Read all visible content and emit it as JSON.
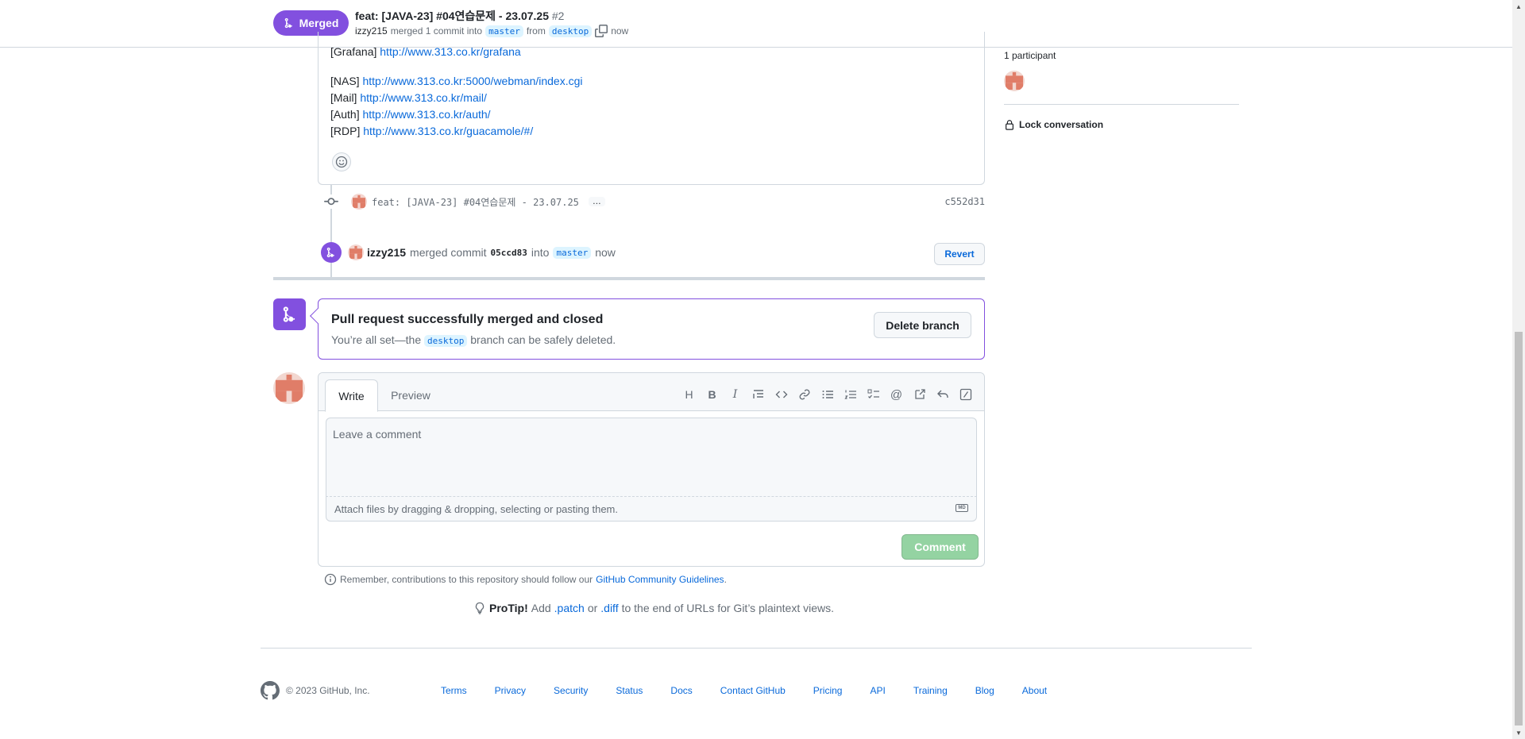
{
  "header": {
    "state_label": "Merged",
    "title": "feat: [JAVA-23] #04연습문제 - 23.07.25",
    "number": "#2",
    "author": "izzy215",
    "merged_text": "merged 1 commit into",
    "base_branch": "master",
    "from_text": "from",
    "head_branch": "desktop",
    "time": "now"
  },
  "body_links": [
    {
      "prefix": "[Grafana]",
      "url": "http://www.313.co.kr/grafana"
    },
    {
      "prefix": "[NAS]",
      "url": "http://www.313.co.kr:5000/webman/index.cgi"
    },
    {
      "prefix": "[Mail]",
      "url": "http://www.313.co.kr/mail/"
    },
    {
      "prefix": "[Auth]",
      "url": "http://www.313.co.kr/auth/"
    },
    {
      "prefix": "[RDP]",
      "url": "http://www.313.co.kr/guacamole/#/"
    }
  ],
  "commit": {
    "message": "feat: [JAVA-23] #04연습문제 - 23.07.25",
    "ellipsis": "…",
    "sha": "c552d31"
  },
  "merge_event": {
    "user": "izzy215",
    "text1": "merged commit",
    "sha": "05ccd83",
    "text2": "into",
    "branch": "master",
    "time": "now",
    "revert_label": "Revert"
  },
  "merged_card": {
    "title": "Pull request successfully merged and closed",
    "desc_pre": "You’re all set—the",
    "branch": "desktop",
    "desc_post": "branch can be safely deleted.",
    "delete_label": "Delete branch"
  },
  "new_comment": {
    "tab_write": "Write",
    "tab_preview": "Preview",
    "placeholder": "Leave a comment",
    "attach_text": "Attach files by dragging & dropping, selecting or pasting them.",
    "md_badge": "MD",
    "submit_label": "Comment",
    "toolbar": [
      "heading-icon",
      "bold-icon",
      "italic-icon",
      "quote-icon",
      "code-icon",
      "link-icon",
      "bulleted-list-icon",
      "numbered-list-icon",
      "task-list-icon",
      "mention-icon",
      "cross-reference-icon",
      "reply-icon",
      "slash-command-icon"
    ]
  },
  "remember": {
    "text": "Remember, contributions to this repository should follow our",
    "link": "GitHub Community Guidelines",
    "end": "."
  },
  "protip": {
    "label": "ProTip!",
    "t1": "Add",
    "patch": ".patch",
    "t2": "or",
    "diff": ".diff",
    "t3": "to the end of URLs for Git’s plaintext views."
  },
  "sidebar": {
    "participants": "1 participant",
    "lock_label": "Lock conversation"
  },
  "footer": {
    "copyright": "© 2023 GitHub, Inc.",
    "links": [
      "Terms",
      "Privacy",
      "Security",
      "Status",
      "Docs",
      "Contact GitHub",
      "Pricing",
      "API",
      "Training",
      "Blog",
      "About"
    ]
  },
  "colors": {
    "merged_purple": "#8250df",
    "link_blue": "#0969da",
    "comment_green_disabled": "#94d3a2"
  }
}
